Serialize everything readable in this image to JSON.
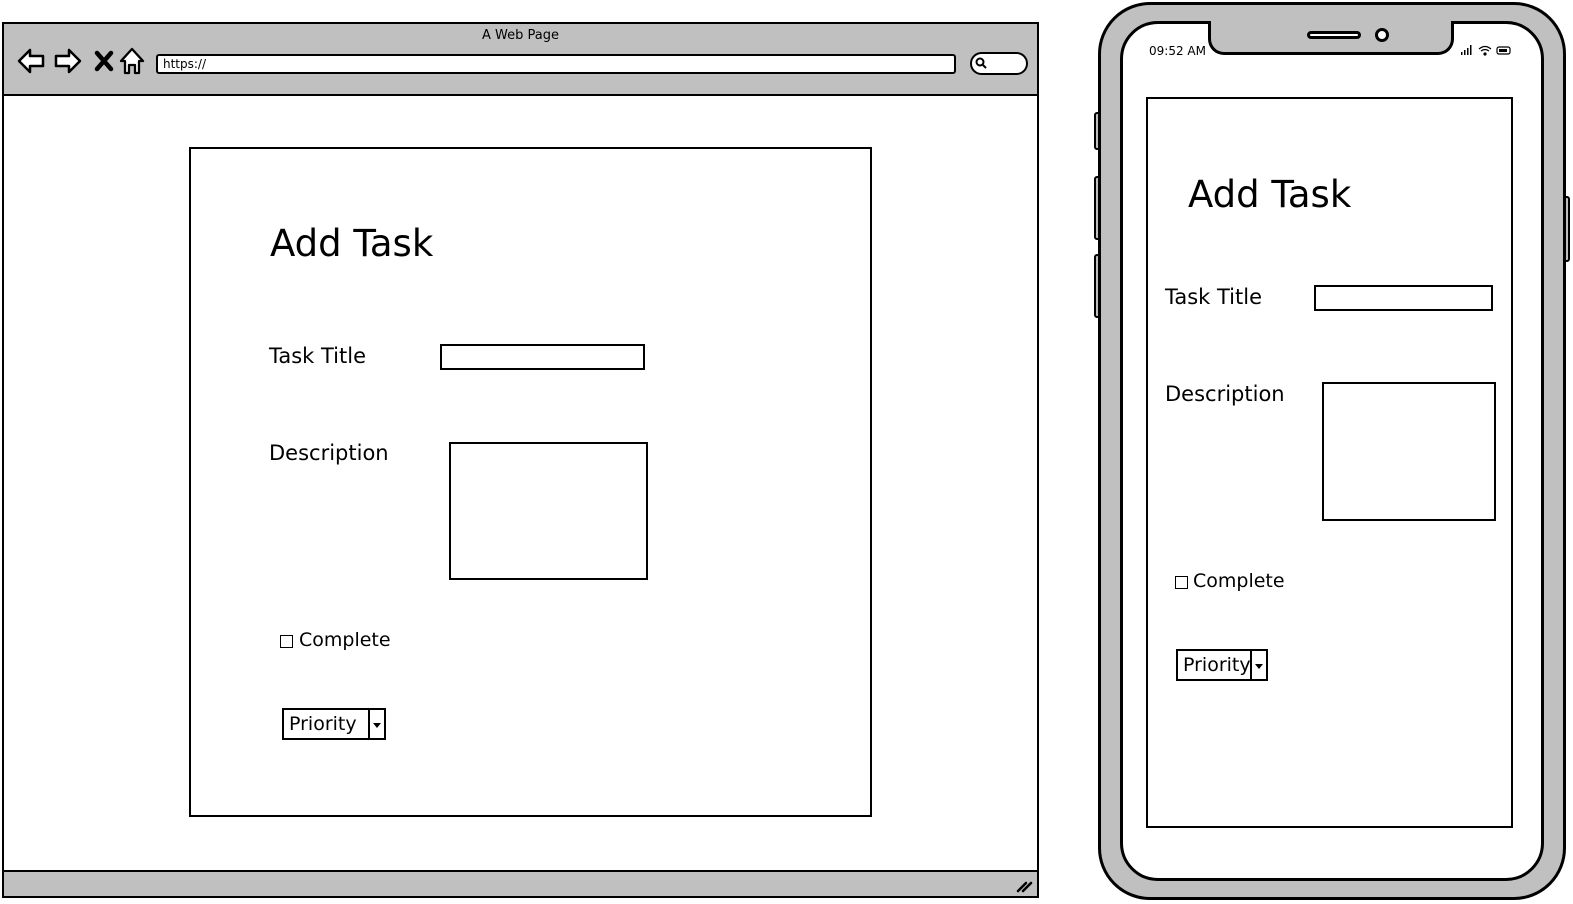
{
  "browser": {
    "title": "A Web Page",
    "url": "https://",
    "icons": [
      "back-arrow-icon",
      "forward-arrow-icon",
      "close-icon",
      "home-icon",
      "search-icon",
      "resize-grip-icon"
    ]
  },
  "desktop_form": {
    "title": "Add Task",
    "task_title_label": "Task Title",
    "task_title_value": "",
    "description_label": "Description",
    "description_value": "",
    "complete_label": "Complete",
    "complete_checked": false,
    "priority_selected": "Priority"
  },
  "phone": {
    "status_time": "09:52 AM",
    "icons": [
      "signal-icon",
      "wifi-icon",
      "battery-icon"
    ],
    "form": {
      "title": "Add Task",
      "task_title_label": "Task Title",
      "task_title_value": "",
      "description_label": "Description",
      "description_value": "",
      "complete_label": "Complete",
      "complete_checked": false,
      "priority_selected": "Priority"
    }
  },
  "colors": {
    "chrome": "#c0c0c0",
    "stroke": "#000000",
    "background": "#ffffff"
  }
}
